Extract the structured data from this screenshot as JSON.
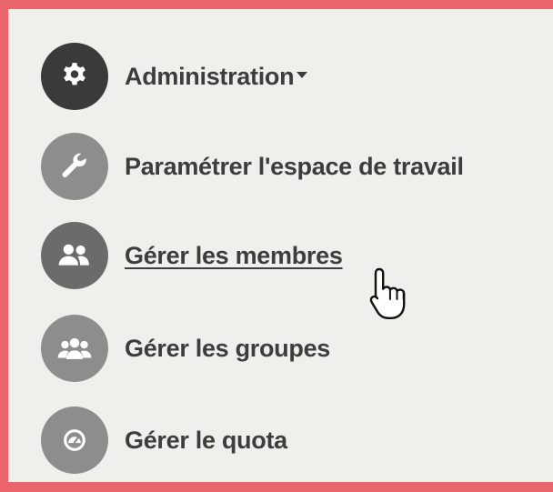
{
  "menu": {
    "items": [
      {
        "label": "Administration",
        "icon": "gear-icon",
        "has_dropdown": true
      },
      {
        "label": "Paramétrer l'espace de travail",
        "icon": "wrench-icon"
      },
      {
        "label": "Gérer les membres",
        "icon": "members-icon",
        "hovered": true
      },
      {
        "label": "Gérer les groupes",
        "icon": "groups-icon"
      },
      {
        "label": "Gérer le quota",
        "icon": "gauge-icon"
      }
    ]
  },
  "colors": {
    "background_border": "#e8666b",
    "panel": "#efefec",
    "icon_dark": "#3a3a3a",
    "icon_gray": "#8d8d8d",
    "text": "#3d3d3d"
  },
  "cursor": "hand-pointer-icon"
}
